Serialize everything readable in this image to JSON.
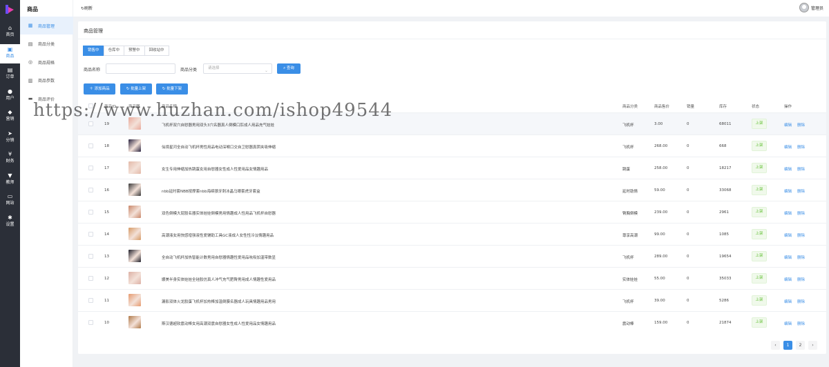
{
  "nav": [
    {
      "icon": "home-icon",
      "label": "首页",
      "active": false
    },
    {
      "icon": "goods-icon",
      "label": "商品",
      "active": true
    },
    {
      "icon": "order-icon",
      "label": "订单",
      "active": false
    },
    {
      "icon": "user-icon",
      "label": "用户",
      "active": false
    },
    {
      "icon": "marketing-icon",
      "label": "营销",
      "active": false
    },
    {
      "icon": "distribution-icon",
      "label": "分销",
      "active": false
    },
    {
      "icon": "finance-icon",
      "label": "财务",
      "active": false
    },
    {
      "icon": "teacher-icon",
      "label": "教师",
      "active": false
    },
    {
      "icon": "website-icon",
      "label": "网站",
      "active": false
    },
    {
      "icon": "settings-icon",
      "label": "设置",
      "active": false
    }
  ],
  "sub": {
    "title": "商品",
    "items": [
      {
        "icon": "manage-icon",
        "label": "商品管理",
        "active": true
      },
      {
        "icon": "category-icon",
        "label": "商品分类",
        "active": false
      },
      {
        "icon": "spec-icon",
        "label": "商品规格",
        "active": false
      },
      {
        "icon": "param-icon",
        "label": "商品参数",
        "active": false
      },
      {
        "icon": "review-icon",
        "label": "商品评价",
        "active": false
      }
    ]
  },
  "topbar": {
    "refresh": "刷新",
    "username": "管理员"
  },
  "card": {
    "title": "商品管理"
  },
  "tabs": [
    "销售中",
    "仓库中",
    "预警中",
    "回收站中"
  ],
  "filter": {
    "name_label": "商品名称",
    "name_value": "",
    "category_label": "商品分类",
    "category_placeholder": "请选择",
    "query": "查询"
  },
  "actions": {
    "add": "添加商品",
    "batch_on": "批量上架",
    "batch_off": "批量下架"
  },
  "watermark": "https://www.huzhan.com/ishop49544",
  "table": {
    "headers": {
      "id": "商品ID",
      "image": "商品图",
      "name": "商品名称",
      "category": "商品分类",
      "price": "商品售价",
      "sales": "销量",
      "stock": "库存",
      "status": "状态",
      "ops": "操作"
    },
    "edit": "编辑",
    "delete": "删除",
    "rows": [
      {
        "id": "19",
        "name": "飞机杯双穴自慰器男用双头3穴名器真人倒模口肛成人用品充气娃娃",
        "category": "飞机杯",
        "price": "3.00",
        "sales": "0",
        "stock": "68011",
        "status": "上架",
        "thumb": "#e8a89a"
      },
      {
        "id": "18",
        "name": "仙境星河全自动飞机杯男性用品电动深喉口交自卫慰器真阴夹吸伸缩",
        "category": "飞机杯",
        "price": "268.00",
        "sales": "0",
        "stock": "668",
        "status": "上架",
        "thumb": "#2a2440"
      },
      {
        "id": "17",
        "name": "女生专用伸缩加热跳蛋女用自慰器女性成人性爱用品女情趣用品",
        "category": "跳蛋",
        "price": "258.00",
        "sales": "0",
        "stock": "18217",
        "status": "上架",
        "thumb": "#e3b9a8"
      },
      {
        "id": "16",
        "name": "nbb延时套NBB按摩套nbb海绵狼牙刺冰晶马眼套虎牙套盒",
        "category": "延时助情",
        "price": "59.00",
        "sales": "0",
        "stock": "33068",
        "status": "上架",
        "thumb": "#3a3a3a"
      },
      {
        "id": "15",
        "name": "双色倒模大屁股名器实体娃娃倒模男用情趣成人性用品飞机杯自慰器",
        "category": "臀胸倒模",
        "price": "239.00",
        "sales": "0",
        "stock": "2961",
        "status": "上架",
        "thumb": "#c9876a"
      },
      {
        "id": "14",
        "name": "高潮液女用快感增强液性爱辅助工具GC液成人女性性冷淡情趣用品",
        "category": "尊享高潮",
        "price": "99.00",
        "sales": "0",
        "stock": "1085",
        "status": "上架",
        "thumb": "#d69a66"
      },
      {
        "id": "13",
        "name": "全自动飞机杯加热智能计数男用自慰器情趣性爱用品吮吸加温带数显",
        "category": "飞机杯",
        "price": "289.00",
        "sales": "0",
        "stock": "19654",
        "status": "上架",
        "thumb": "#1f1f2a"
      },
      {
        "id": "12",
        "name": "娜美半身实体娃娃全硅胶仿真人冲气充气肥臀男用成人情趣性爱用品",
        "category": "实体娃娃",
        "price": "55.00",
        "sales": "0",
        "stock": "35033",
        "status": "上架",
        "thumb": "#dcb0a4"
      },
      {
        "id": "11",
        "name": "漏影双体火龙胶蛋飞机杯加热棒加温倒膜名器成人玩具情趣用品男用",
        "category": "飞机杯",
        "price": "39.00",
        "sales": "0",
        "stock": "5286",
        "status": "上架",
        "thumb": "#e69a6e"
      },
      {
        "id": "10",
        "name": "斯汉德超软震动棒女用高潮双震自慰器女性成人性爱用品女情趣用品",
        "category": "震动棒",
        "price": "159.00",
        "sales": "0",
        "stock": "21874",
        "status": "上架",
        "thumb": "#b07a4a"
      }
    ]
  },
  "pagination": {
    "prev": "‹",
    "pages": [
      "1",
      "2"
    ],
    "current": "1",
    "next": "›"
  }
}
